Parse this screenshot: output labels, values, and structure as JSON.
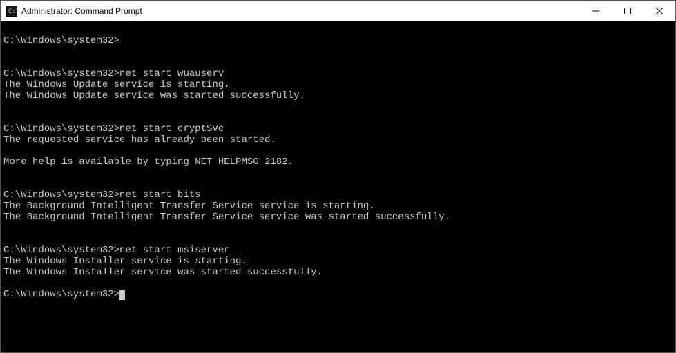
{
  "window": {
    "title": "Administrator: Command Prompt"
  },
  "terminal": {
    "prompt": "C:\\Windows\\system32>",
    "blocks": [
      {
        "command": "",
        "output": []
      },
      {
        "command": "net start wuauserv",
        "output": [
          "The Windows Update service is starting.",
          "The Windows Update service was started successfully."
        ]
      },
      {
        "command": "net start cryptSvc",
        "output": [
          "The requested service has already been started.",
          "",
          "More help is available by typing NET HELPMSG 2182."
        ]
      },
      {
        "command": "net start bits",
        "output": [
          "The Background Intelligent Transfer Service service is starting.",
          "The Background Intelligent Transfer Service service was started successfully."
        ]
      },
      {
        "command": "net start msiserver",
        "output": [
          "The Windows Installer service is starting.",
          "The Windows Installer service was started successfully."
        ]
      }
    ]
  }
}
